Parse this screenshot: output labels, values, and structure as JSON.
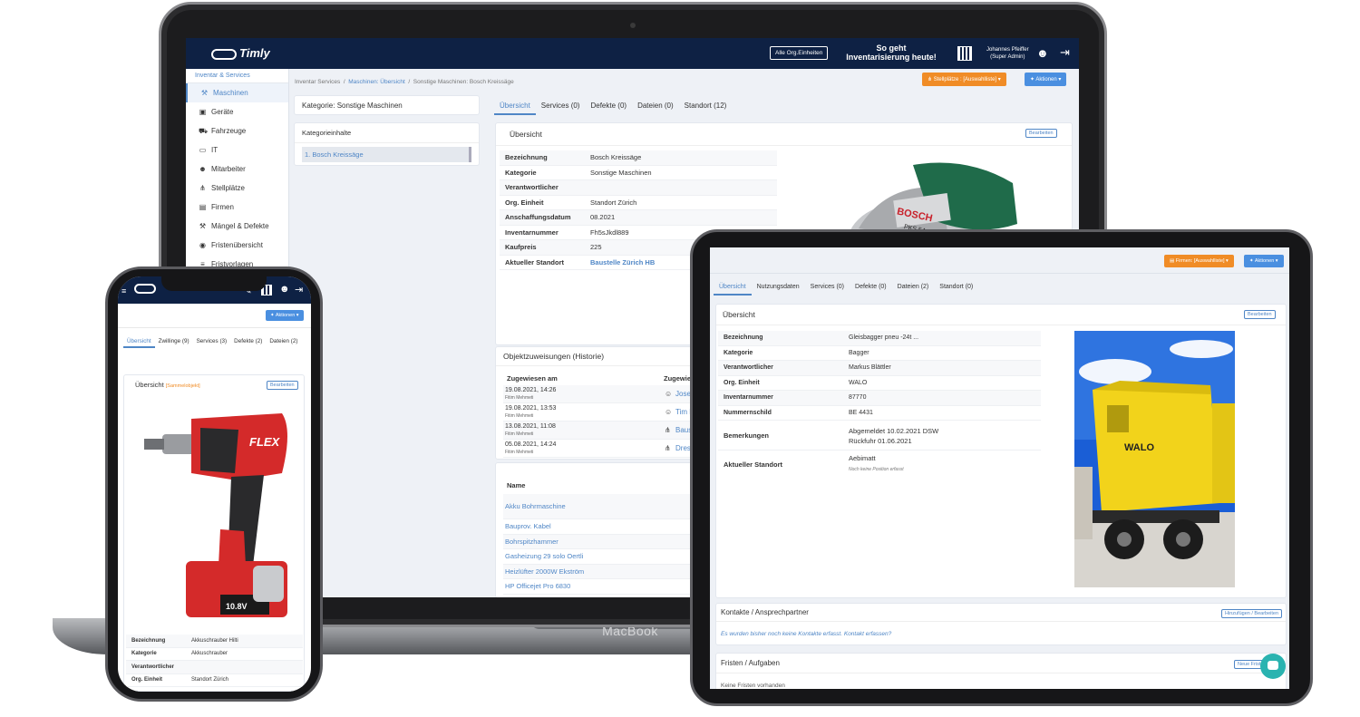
{
  "laptop": {
    "brand": "MacBook",
    "logo": "Timly",
    "org_button": "Alle Org.Einheiten",
    "promo_line1": "So geht",
    "promo_line2": "Inventarisierung heute!",
    "user_name": "Johannes Pfeiffer",
    "user_role": "(Super Admin)",
    "sidebar_caption": "Inventar & Services",
    "sidebar": [
      {
        "label": "Maschinen",
        "icon": "wrench-icon",
        "glyph": "⚒"
      },
      {
        "label": "Geräte",
        "icon": "box-icon",
        "glyph": "▣"
      },
      {
        "label": "Fahrzeuge",
        "icon": "car-icon",
        "glyph": "⛟"
      },
      {
        "label": "IT",
        "icon": "monitor-icon",
        "glyph": "▭"
      },
      {
        "label": "Mitarbeiter",
        "icon": "users-icon",
        "glyph": "☻"
      },
      {
        "label": "Stellplätze",
        "icon": "sitemap-icon",
        "glyph": "⋔"
      },
      {
        "label": "Firmen",
        "icon": "building-icon",
        "glyph": "▤"
      },
      {
        "label": "Mängel & Defekte",
        "icon": "wrench-icon",
        "glyph": "⚒"
      },
      {
        "label": "Fristenübersicht",
        "icon": "eye-icon",
        "glyph": "◉"
      },
      {
        "label": "Fristvorlagen",
        "icon": "list-icon",
        "glyph": "≡"
      }
    ],
    "breadcrumb": [
      "Inventar Services",
      "Maschinen: Übersicht",
      "Sonstige Maschinen: Bosch Kreissäge"
    ],
    "stellplaetze_btn": "Stellplätze : [Auswahlliste]",
    "aktionen_btn": "Aktionen",
    "kategorie_title": "Kategorie: Sonstige Maschinen",
    "kategorieinhalte": "Kategorieinhalte",
    "kategorie_item": "1.  Bosch Kreissäge",
    "tabs": [
      "Übersicht",
      "Services (0)",
      "Defekte (0)",
      "Dateien (0)",
      "Standort (12)"
    ],
    "uebersicht": "Übersicht",
    "bearbeiten": "Bearbeiten",
    "fields": [
      {
        "k": "Bezeichnung",
        "v": "Bosch Kreissäge"
      },
      {
        "k": "Kategorie",
        "v": "Sonstige Maschinen"
      },
      {
        "k": "Verantwortlicher",
        "v": ""
      },
      {
        "k": "Org. Einheit",
        "v": "Standort Zürich"
      },
      {
        "k": "Anschaffungsdatum",
        "v": "08.2021"
      },
      {
        "k": "Inventarnummer",
        "v": "Fh5sJkdl889"
      },
      {
        "k": "Kaufpreis",
        "v": "225"
      },
      {
        "k": "Aktueller Standort",
        "v": "Baustelle Zürich HB"
      }
    ],
    "historie_title": "Objektzuweisungen (Historie)",
    "historie_col1": "Zugewiesen am",
    "historie_col2": "Zugewie",
    "historie": [
      {
        "date": "19.08.2021, 14:26",
        "by": "Fitim Mehmeti",
        "to": "Josep"
      },
      {
        "date": "19.08.2021, 13:53",
        "by": "Fitim Mehmeti",
        "to": "Tim B"
      },
      {
        "date": "13.08.2021, 11:08",
        "by": "Fitim Mehmeti",
        "to": "Baust"
      },
      {
        "date": "05.08.2021, 14:24",
        "by": "Fitim Mehmeti",
        "to": "Dresd"
      }
    ],
    "name_col": "Name",
    "names": [
      "Akku Bohrmaschine",
      "Bauprov. Kabel",
      "Bohrspitzhammer",
      "Gasheizung 29 solo Oertli",
      "Heizlüfter 2000W Ekström",
      "HP Officejet Pro 6830"
    ],
    "saw_brand": "BOSCH",
    "saw_model": "PKS 54 CE"
  },
  "phone": {
    "aktionen": "Aktionen",
    "tabs": [
      "Übersicht",
      "Zwillinge (9)",
      "Services (3)",
      "Defekte (2)",
      "Dateien (2)"
    ],
    "uebersicht": "Übersicht",
    "sammelobjekt": "[Sammelobjekt]",
    "bearbeiten": "Bearbeiten",
    "drill_brand": "FLEX",
    "battery_label": "10.8V",
    "fields": [
      {
        "k": "Bezeichnung",
        "v": "Akkuschrauber Hilti"
      },
      {
        "k": "Kategorie",
        "v": "Akkuschrauber"
      },
      {
        "k": "Verantwortlicher",
        "v": ""
      },
      {
        "k": "Org. Einheit",
        "v": "Standort Zürich"
      }
    ]
  },
  "tablet": {
    "firmen_btn": "Firmen: [Auswahlliste]",
    "aktionen_btn": "Aktionen",
    "tabs": [
      "Übersicht",
      "Nutzungsdaten",
      "Services (0)",
      "Defekte (0)",
      "Dateien (2)",
      "Standort (0)"
    ],
    "uebersicht": "Übersicht",
    "bearbeiten": "Bearbeiten",
    "fields": [
      {
        "k": "Bezeichnung",
        "v": "Gleisbagger pneu -24t ..."
      },
      {
        "k": "Kategorie",
        "v": "Bagger"
      },
      {
        "k": "Verantwortlicher",
        "v": "Markus Blättler"
      },
      {
        "k": "Org. Einheit",
        "v": "WALO"
      },
      {
        "k": "Inventarnummer",
        "v": "87770"
      },
      {
        "k": "Nummernschild",
        "v": "BE 4431"
      }
    ],
    "bemerkungen_k": "Bemerkungen",
    "bemerkungen_v1": "Abgemeldet 10.02.2021 DSW",
    "bemerkungen_v2": "Rückfuhr 01.06.2021",
    "standort_k": "Aktueller Standort",
    "standort_v": "Aebimatt",
    "standort_note": "Noch keine Position erfasst",
    "machine_label": "WALO",
    "kontakte_title": "Kontakte / Ansprechpartner",
    "kontakte_btn": "Hinzufügen / Bearbeiten",
    "kontakte_text": "Es wurden bisher noch keine Kontakte erfasst.",
    "kontakte_link": "Kontakt erfassen?",
    "fristen_title": "Fristen / Aufgaben",
    "fristen_btn": "Neue Frist e",
    "fristen_text": "Keine Fristen vorhanden"
  },
  "colors": {
    "navy": "#0e2144",
    "accent": "#4f86c6",
    "orange": "#f08c26",
    "blue_btn": "#4a8fe0",
    "machine_yellow": "#f2d31b",
    "drill_red": "#d42a2a",
    "saw_green": "#1f6b4a"
  }
}
